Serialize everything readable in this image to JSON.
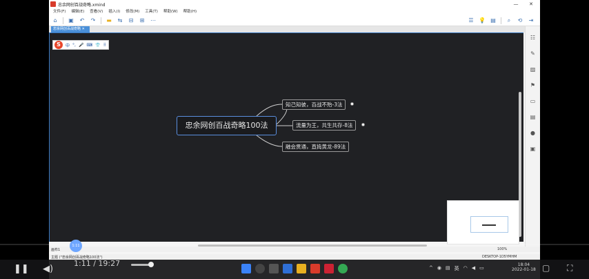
{
  "window": {
    "title": "忠余网创百战奇略.xmind",
    "minimize": "—",
    "close": "✕"
  },
  "menu": [
    "文件(F)",
    "编辑(E)",
    "查看(V)",
    "插入(I)",
    "修改(M)",
    "工具(T)",
    "帮助(W)",
    "帮助(H)"
  ],
  "tab": {
    "label": "忠余网创百战奇略"
  },
  "ime": {
    "logo": "S",
    "items": [
      "中",
      "°,",
      "🎤",
      "⌨",
      "👕",
      "⠿"
    ]
  },
  "mindmap": {
    "central": "忠余网创百战奇略100法",
    "branches": [
      {
        "label": "知己知彼，百战不殆-3法"
      },
      {
        "label": "流量为王，共生共存-8法"
      },
      {
        "label": "融会贯通，直捣黄龙-89法"
      }
    ]
  },
  "status": {
    "sheet": "画布1",
    "zoom": "100%",
    "bottom_left": "主题 (\"忠余网创百战奇略100法\")",
    "bottom_right": "DESKTOP-1D5YMHM"
  },
  "player": {
    "time": "1:11 / 19:27",
    "knob": "1:11"
  },
  "clock": {
    "time": "18:04",
    "date": "2022-01-18"
  },
  "tray": {
    "lang": "英"
  }
}
